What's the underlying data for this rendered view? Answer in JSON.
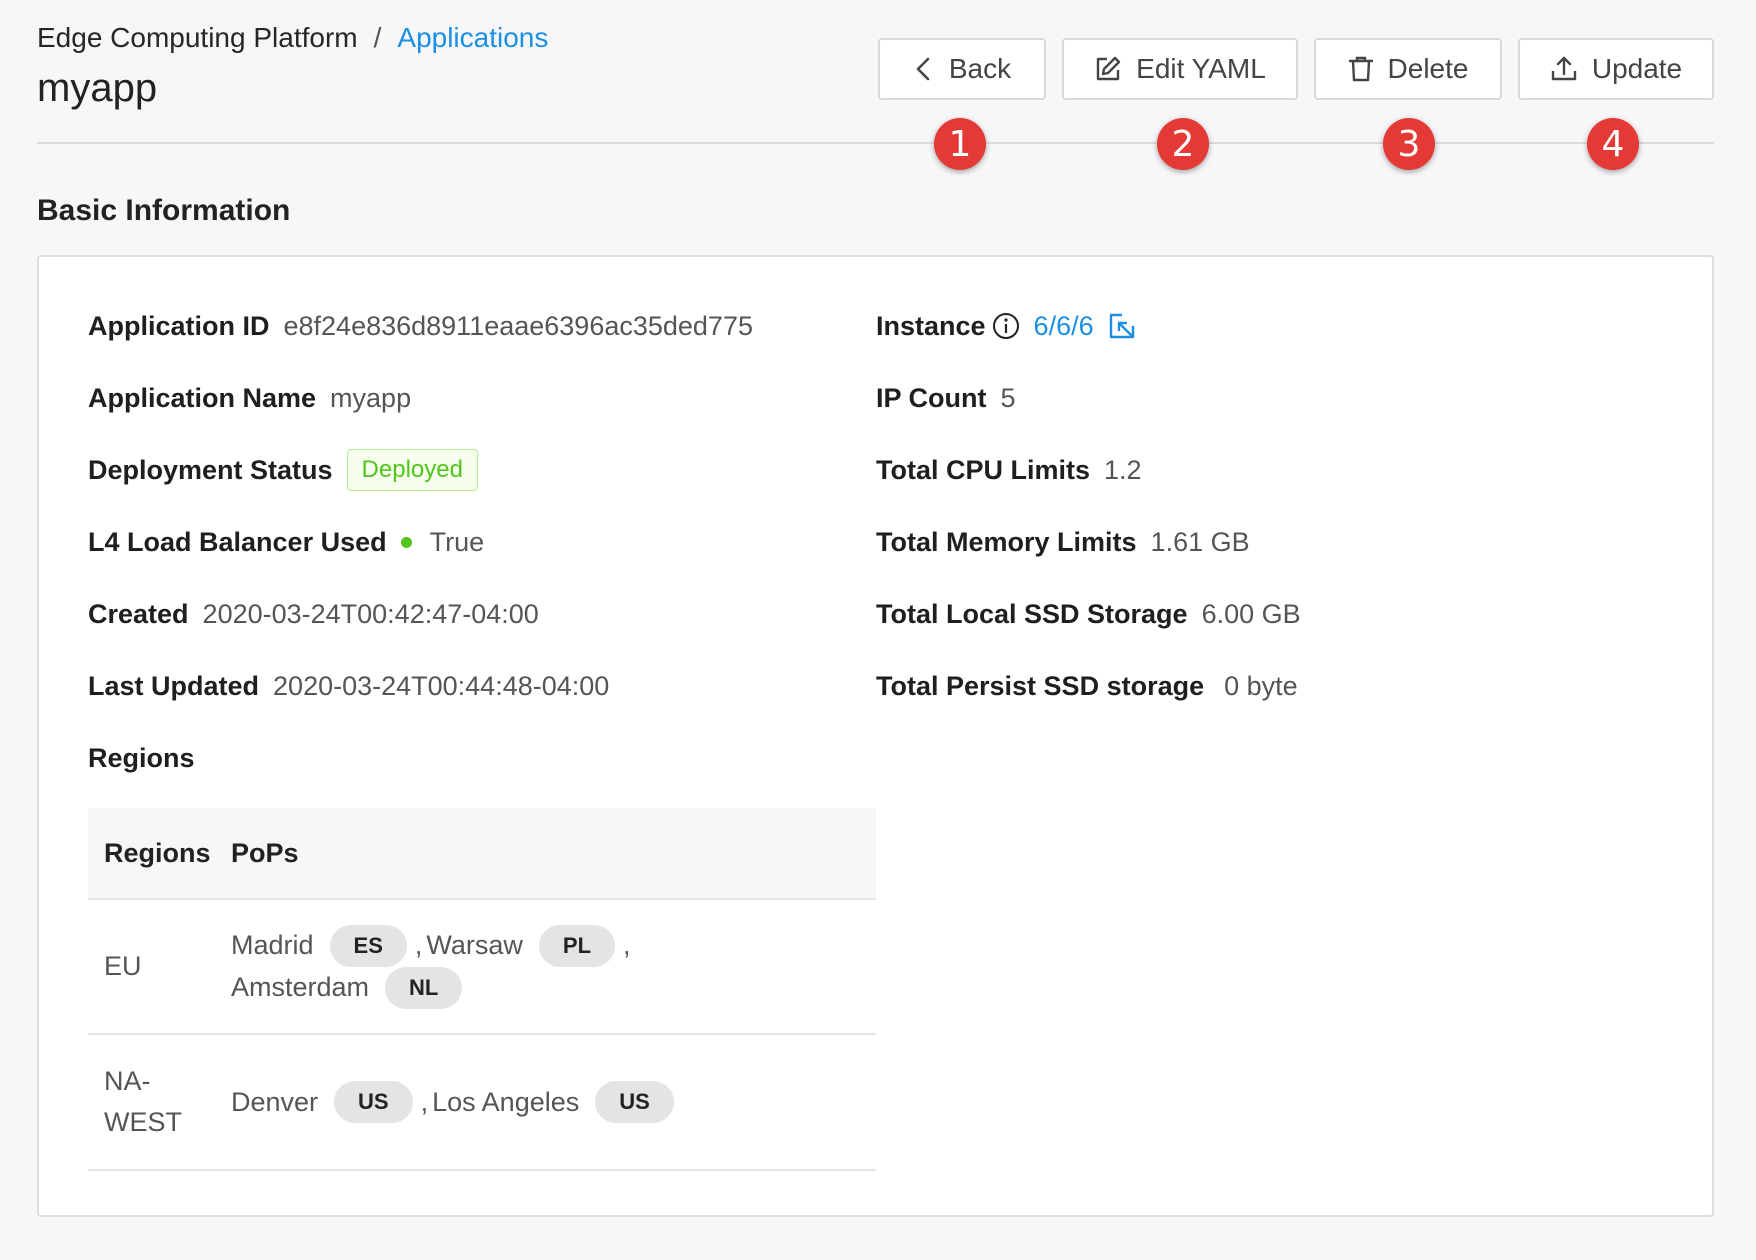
{
  "header": {
    "breadcrumb_root": "Edge Computing Platform",
    "breadcrumb_separator": "/",
    "breadcrumb_current": "Applications",
    "title": "myapp"
  },
  "toolbar": {
    "back_label": "Back",
    "edit_label": "Edit YAML",
    "delete_label": "Delete",
    "update_label": "Update"
  },
  "markers": [
    "1",
    "2",
    "3",
    "4"
  ],
  "basic_info": {
    "section_title": "Basic Information",
    "application_id_label": "Application ID",
    "application_id": "e8f24e836d8911eaae6396ac35ded775",
    "application_name_label": "Application Name",
    "application_name": "myapp",
    "deployment_status_label": "Deployment Status",
    "deployment_status": "Deployed",
    "l4_lb_label": "L4 Load Balancer Used",
    "l4_lb_value": "True",
    "created_label": "Created",
    "created": "2020-03-24T00:42:47-04:00",
    "last_updated_label": "Last Updated",
    "last_updated": "2020-03-24T00:44:48-04:00",
    "regions_label": "Regions",
    "instance_label": "Instance",
    "instance_value": "6/6/6",
    "ip_count_label": "IP Count",
    "ip_count": "5",
    "cpu_label": "Total CPU Limits",
    "cpu_value": "1.2",
    "memory_label": "Total Memory Limits",
    "memory_value": "1.61 GB",
    "local_ssd_label": "Total Local SSD Storage",
    "local_ssd_value": "6.00 GB",
    "persist_ssd_label": "Total Persist SSD storage",
    "persist_ssd_value": "0 byte"
  },
  "regions_table": {
    "columns": [
      "Regions",
      "PoPs"
    ],
    "rows": [
      {
        "region_line1": "EU",
        "region_line2": "",
        "pops": [
          {
            "city": "Madrid",
            "code": "ES",
            "suffix": ","
          },
          {
            "city": "Warsaw",
            "code": "PL",
            "suffix": ","
          },
          {
            "city": "Amsterdam",
            "code": "NL",
            "suffix": ""
          }
        ]
      },
      {
        "region_line1": "NA-",
        "region_line2": "WEST",
        "pops": [
          {
            "city": "Denver",
            "code": "US",
            "suffix": ","
          },
          {
            "city": "Los Angeles",
            "code": "US",
            "suffix": ""
          }
        ]
      }
    ]
  },
  "colors": {
    "link": "#1a8fe3",
    "marker": "#e53935",
    "deployed_text": "#52c41a",
    "deployed_bg": "#f6ffed",
    "status_dot": "#52c41a"
  },
  "icons": {
    "back": "chevron-left-icon",
    "edit": "edit-icon",
    "delete": "trash-icon",
    "update": "upload-icon",
    "instance_info": "info-icon",
    "instance_jump": "external-link-icon"
  }
}
